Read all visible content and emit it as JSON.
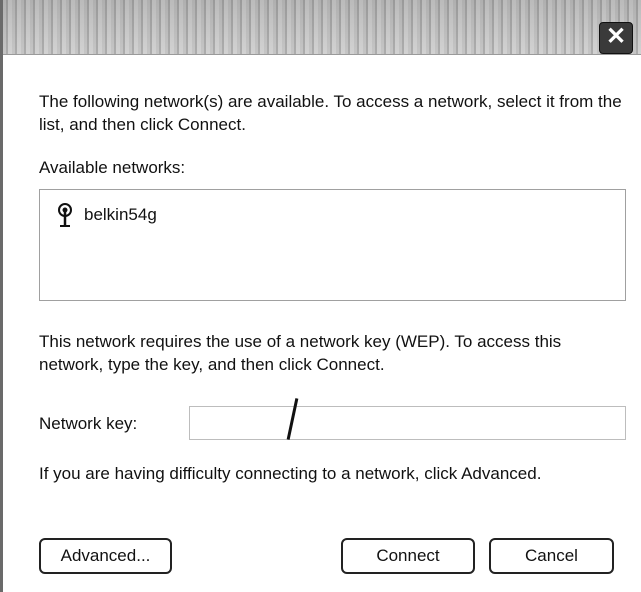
{
  "window": {
    "title": "",
    "close_symbol": "✕"
  },
  "intro_text": "The following network(s) are available. To access a network, select it from the list, and then click Connect.",
  "available_networks_label": "Available networks:",
  "networks": [
    {
      "name": "belkin54g",
      "icon": "wireless-antenna-icon"
    }
  ],
  "wep_text": "This network requires the use of a network key (WEP). To access this network, type the key, and then click Connect.",
  "network_key": {
    "label": "Network key:",
    "value": ""
  },
  "help_text": "If you are having difficulty connecting to a network, click Advanced.",
  "buttons": {
    "advanced": "Advanced...",
    "connect": "Connect",
    "cancel": "Cancel"
  }
}
